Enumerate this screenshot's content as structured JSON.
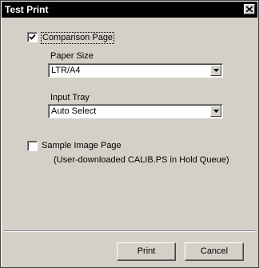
{
  "window": {
    "title": "Test Print",
    "close_label": "close"
  },
  "comparison_page": {
    "label": "Comparison Page",
    "checked": true
  },
  "paper_size": {
    "label": "Paper Size",
    "value": "LTR/A4"
  },
  "input_tray": {
    "label": "Input Tray",
    "value": "Auto Select"
  },
  "sample_image_page": {
    "label": "Sample Image Page",
    "checked": false,
    "note": "(User-downloaded CALIB.PS in Hold Queue)"
  },
  "buttons": {
    "print": "Print",
    "cancel": "Cancel"
  },
  "icons": {
    "close": "close-icon",
    "check": "checkmark-icon",
    "dropdown": "chevron-down-icon"
  }
}
